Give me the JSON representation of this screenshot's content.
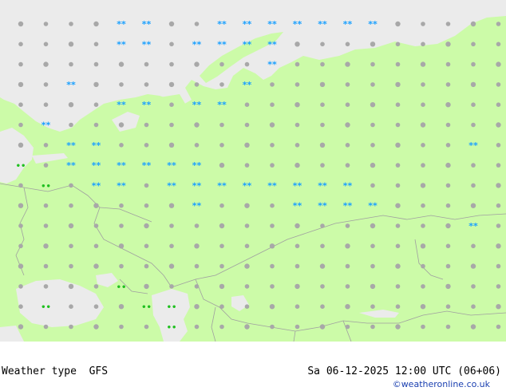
{
  "footer": {
    "parameter": "Weather type",
    "model": "GFS",
    "valid_time": "Sa 06-12-2025 12:00 UTC (06+06)",
    "credit": "©weatheronline.co.uk"
  },
  "colors": {
    "land": "#ccfba8",
    "sea": "#ebebeb",
    "border": "#a0a0a0",
    "dot": "#a8a8a8",
    "snow": "#1aa0ff",
    "rain": "#20c020"
  },
  "legend_symbols": [
    "dry",
    "cloudy",
    "snow",
    "rain"
  ]
}
